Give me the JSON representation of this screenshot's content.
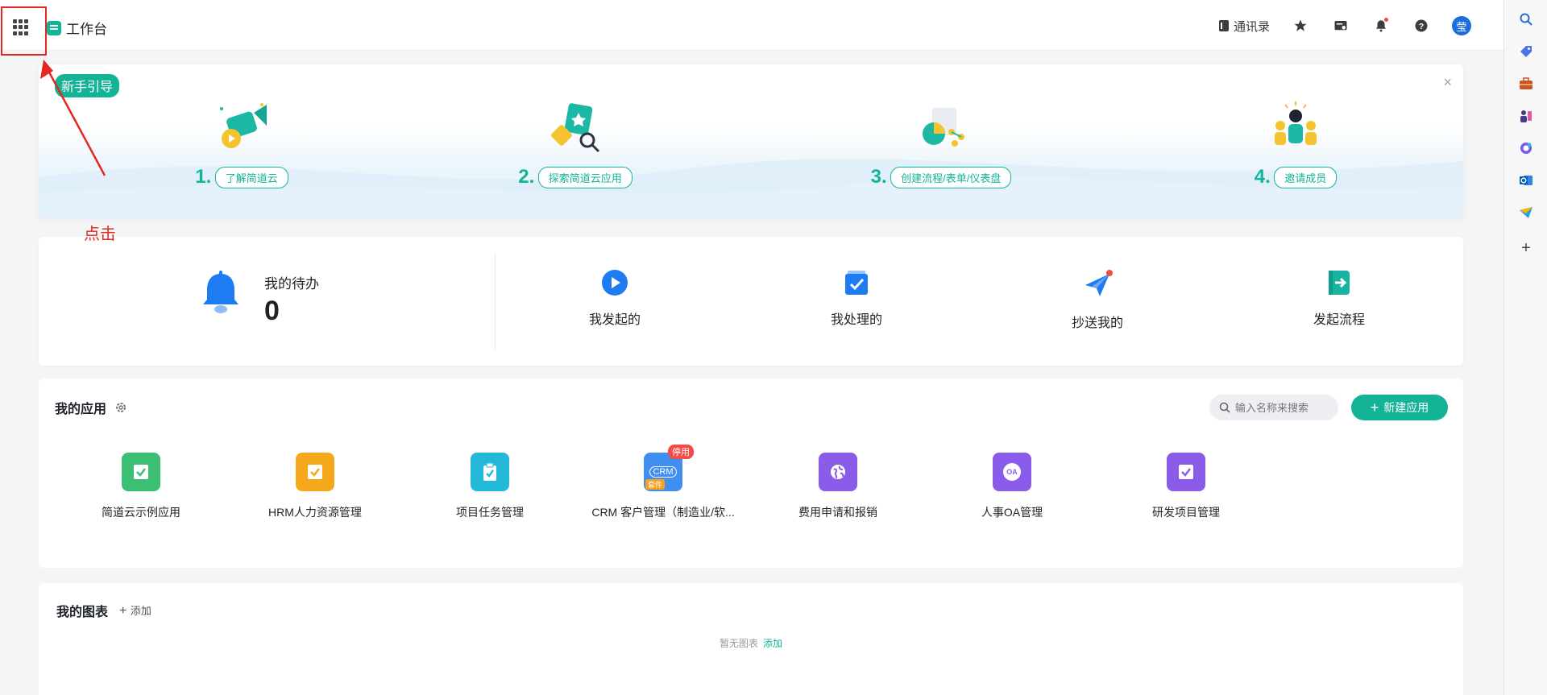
{
  "header": {
    "app_title": "工作台",
    "contacts_label": "通讯录",
    "avatar_text": "莹"
  },
  "annotation": {
    "click_text": "点击"
  },
  "guide": {
    "tag": "新手引导",
    "close": "×",
    "steps": [
      {
        "num": "1.",
        "label": "了解简道云"
      },
      {
        "num": "2.",
        "label": "探索简道云应用"
      },
      {
        "num": "3.",
        "label": "创建流程/表单/仪表盘"
      },
      {
        "num": "4.",
        "label": "邀请成员"
      }
    ]
  },
  "todo": {
    "title": "我的待办",
    "count": "0",
    "actions": [
      {
        "label": "我发起的"
      },
      {
        "label": "我处理的"
      },
      {
        "label": "抄送我的"
      },
      {
        "label": "发起流程"
      }
    ]
  },
  "apps": {
    "title": "我的应用",
    "search_placeholder": "输入名称来搜索",
    "new_button": "新建应用",
    "items": [
      {
        "name": "简道云示例应用",
        "color": "#3bbf74"
      },
      {
        "name": "HRM人力资源管理",
        "color": "#f6a81c"
      },
      {
        "name": "项目任务管理",
        "color": "#25b9d9"
      },
      {
        "name": "CRM 客户管理（制造业/软...",
        "color": "#3f8ef0",
        "badge": "停用",
        "trial": "套件",
        "icon_text": "CRM"
      },
      {
        "name": "费用申请和报销",
        "color": "#8b5bea"
      },
      {
        "name": "人事OA管理",
        "color": "#8b5bea",
        "icon_text": "OA"
      },
      {
        "name": "研发项目管理",
        "color": "#8b5bea"
      }
    ]
  },
  "charts": {
    "title": "我的图表",
    "add_label": "添加",
    "empty_text": "暂无图表",
    "empty_add": "添加"
  },
  "colors": {
    "accent": "#13b398",
    "annotation_red": "#e5281f"
  }
}
